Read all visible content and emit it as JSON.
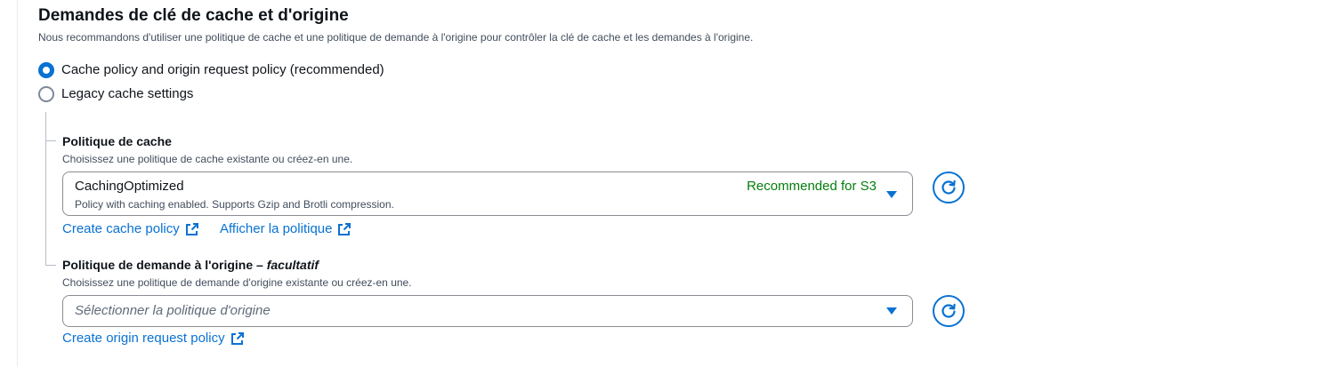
{
  "section": {
    "title": "Demandes de clé de cache et d'origine",
    "description": "Nous recommandons d'utiliser une politique de cache et une politique de demande à l'origine pour contrôler la clé de cache et les demandes à l'origine."
  },
  "options": [
    {
      "label": "Cache policy and origin request policy (recommended)",
      "selected": true
    },
    {
      "label": "Legacy cache settings",
      "selected": false
    }
  ],
  "cache_policy": {
    "label": "Politique de cache",
    "description": "Choisissez une politique de cache existante ou créez-en une.",
    "selected_value": "CachingOptimized",
    "selected_description": "Policy with caching enabled. Supports Gzip and Brotli compression.",
    "tag": "Recommended for S3",
    "create_link": "Create cache policy",
    "view_link": "Afficher la politique"
  },
  "origin_request_policy": {
    "label": "Politique de demande à l'origine – ",
    "label_optional": "facultatif",
    "description": "Choisissez une politique de demande d'origine existante ou créez-en une.",
    "placeholder": "Sélectionner la politique d'origine",
    "create_link": "Create origin request policy"
  },
  "colors": {
    "accent": "#0972d3",
    "success": "#037f0c",
    "text": "#0f141a",
    "muted": "#414d5c"
  },
  "icons": [
    "external-link-icon",
    "refresh-icon",
    "caret-down-icon"
  ]
}
